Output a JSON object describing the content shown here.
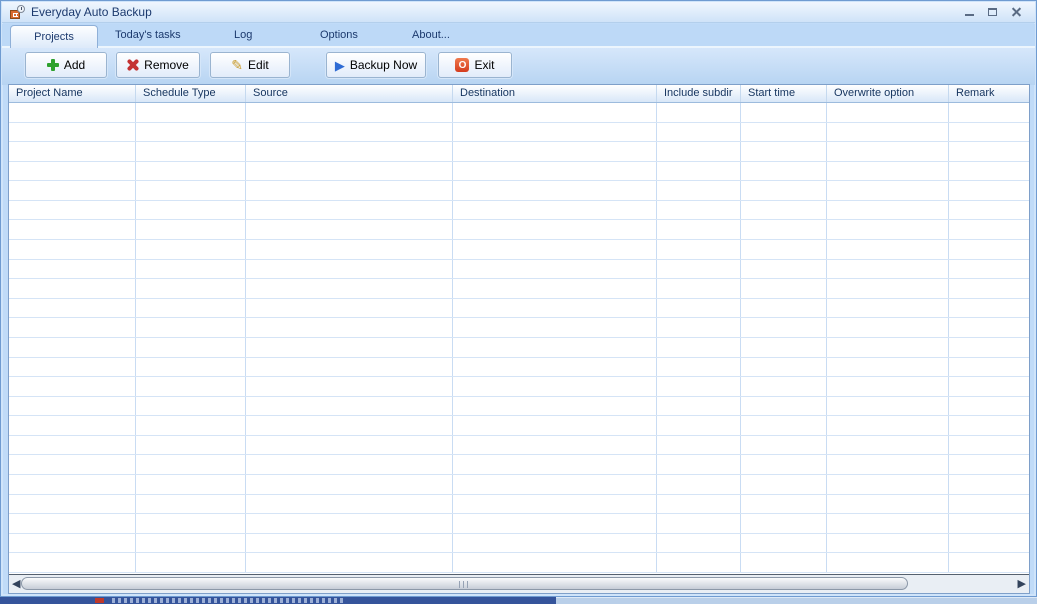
{
  "window": {
    "title": "Everyday Auto Backup",
    "controls": [
      "minimize",
      "maximize",
      "close"
    ]
  },
  "tabs": [
    {
      "label": "Projects",
      "active": true
    },
    {
      "label": "Today's tasks",
      "active": false
    },
    {
      "label": "Log",
      "active": false
    },
    {
      "label": "Options",
      "active": false
    },
    {
      "label": "About...",
      "active": false
    }
  ],
  "toolbar": {
    "buttons": [
      {
        "label": "Add",
        "icon": "add-plus-icon"
      },
      {
        "label": "Remove",
        "icon": "remove-x-icon"
      },
      {
        "label": "Edit",
        "icon": "edit-pencil-icon"
      },
      {
        "label": "Backup Now",
        "icon": "backup-play-icon"
      },
      {
        "label": "Exit",
        "icon": "exit-power-icon"
      }
    ]
  },
  "icons": {
    "edit_glyph": "✎",
    "backup_glyph": "▶",
    "exit_glyph": "O",
    "scroll_left_glyph": "◀",
    "scroll_right_glyph": "▶"
  },
  "table": {
    "columns": [
      "Project Name",
      "Schedule Type",
      "Source",
      "Destination",
      "Include subdir",
      "Start time",
      "Overwrite option",
      "Remark"
    ],
    "rows": [],
    "visible_row_count": 24
  },
  "scrollbar": {
    "orientation": "horizontal"
  },
  "colors": {
    "titlebar_top": "#f0f6fe",
    "titlebar_bottom": "#cfe3f8",
    "panel_blue": "#c0dbf8",
    "tab_text": "#1c3a6e",
    "button_border": "#9ab4d0",
    "header_text": "#15345f",
    "grid_line": "#cfe0f4",
    "add_green": "#2ea12e",
    "remove_red": "#c43232",
    "pencil_gold": "#c89a2a",
    "play_blue": "#2e6bd4",
    "exit_red": "#e2492f",
    "sliver_dark_blue": "#35549b",
    "sliver_light_blue": "#b9cfe9"
  }
}
